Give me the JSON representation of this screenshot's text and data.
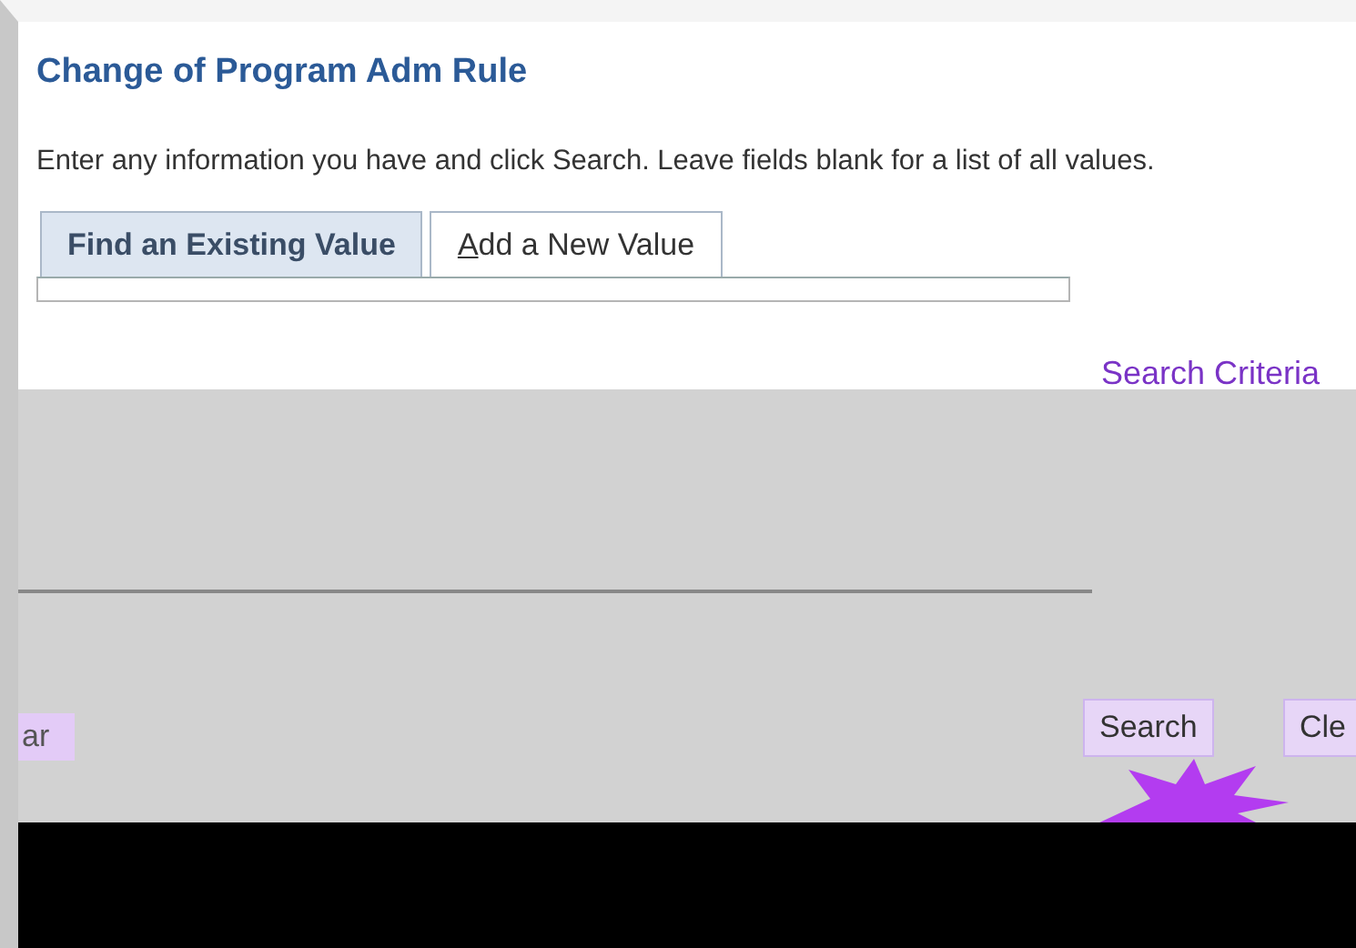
{
  "page": {
    "title": "Change of Program Adm Rule",
    "instructions": "Enter any information you have and click Search. Leave fields blank for a list of all values."
  },
  "tabs": [
    {
      "label": "Find an Existing Value",
      "selected": true
    },
    {
      "label": "Add a New Value",
      "selected": false
    }
  ],
  "search_panel": {
    "heading": "Search Criteria"
  },
  "left_buttons": [
    {
      "label": "ar"
    }
  ],
  "buttons": [
    {
      "label": "Search"
    },
    {
      "label": "Cle"
    }
  ]
}
